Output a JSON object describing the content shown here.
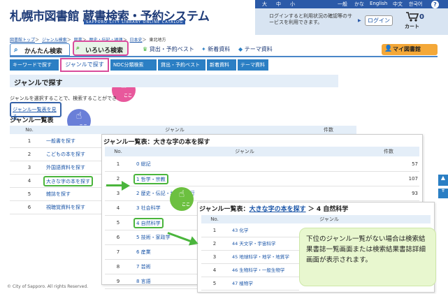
{
  "header": {
    "logo": "札幌市図書館 蔵書検索・予約システム",
    "logo_sub": "SAPPORO CITY LIBRARY ONLINE CATALOG",
    "font_size_controls": [
      "大",
      "中",
      "小"
    ],
    "lang_links": [
      "一般",
      "かな",
      "English",
      "中文",
      "한국어"
    ],
    "help_label": "?",
    "login_message": "ログインすると利用状況の確認等のサービスを利用できます。",
    "login_button": "ログイン",
    "cart_count": "0",
    "cart_label": "カート"
  },
  "breadcrumb": [
    "図書館トップ",
    "ジャンル検索",
    "図書",
    "歴史・伝記・地理",
    "日本史",
    "東北地方"
  ],
  "tabs": {
    "simple": "かんたん検索",
    "various": "いろいろ検索",
    "links": [
      "貸出・予約ベスト",
      "新着資料",
      "テーマ資料"
    ],
    "mylibrary": "マイ図書館"
  },
  "subtabs": [
    "キーワードで探す",
    "ジャンルで探す",
    "NDC分類検索",
    "貸出・予約ベスト",
    "新着資料",
    "テーマ資料"
  ],
  "section_title": "ジャンルで探す",
  "description": "ジャンルを選択することで、検索することができ",
  "genre_list_link": "ジャンル一覧表を見る",
  "hand_label": "ここ",
  "table1": {
    "title": "ジャンル一覧表",
    "headers": [
      "No.",
      "ジャンル",
      "件数"
    ],
    "rows": [
      {
        "no": "1",
        "label": "一般書を探す"
      },
      {
        "no": "2",
        "label": "こどもの本を探す"
      },
      {
        "no": "3",
        "label": "外国語資料を探す"
      },
      {
        "no": "4",
        "label": "大きな字の本を探す"
      },
      {
        "no": "5",
        "label": "雑誌を探す"
      },
      {
        "no": "6",
        "label": "視聴覚資料を探す"
      }
    ]
  },
  "table2": {
    "title": "ジャンル一覧表：大きな字の本を探す",
    "headers": [
      "No.",
      "ジャンル",
      "件数"
    ],
    "rows": [
      {
        "no": "1",
        "label": "0 総記",
        "count": "57"
      },
      {
        "no": "2",
        "label": "1 哲学・宗教",
        "count": "107"
      },
      {
        "no": "3",
        "label": "2 歴史・伝記・地理・紀行",
        "count": "93"
      },
      {
        "no": "4",
        "label": "3 社会科学",
        "count": ""
      },
      {
        "no": "5",
        "label": "4 自然科学",
        "count": ""
      },
      {
        "no": "6",
        "label": "5 技術・家政学",
        "count": ""
      },
      {
        "no": "7",
        "label": "6 産業",
        "count": ""
      },
      {
        "no": "8",
        "label": "7 芸術",
        "count": ""
      },
      {
        "no": "9",
        "label": "8 言語",
        "count": ""
      }
    ]
  },
  "table3": {
    "title_prefix": "ジャンル一覧表：",
    "title_link": "大きな字の本を探す",
    "title_suffix": "＞ 4 自然科学",
    "headers": [
      "No.",
      "ジャンル"
    ],
    "rows": [
      {
        "no": "1",
        "label": "43 化学"
      },
      {
        "no": "2",
        "label": "44 天文学・宇宙科学"
      },
      {
        "no": "3",
        "label": "45 地球科学・地学・地質学"
      },
      {
        "no": "4",
        "label": "46 生物科学・一般生物学"
      },
      {
        "no": "5",
        "label": "47 植物学"
      }
    ]
  },
  "callout": "下位のジャンル一覧がない場合は検索結果書誌一覧画面または検索結果書誌詳細画面が表示されます。",
  "footer": "© City of Sapporo. All rights Reserved.",
  "colors": {
    "accent": "#2b7fc4",
    "highlight_pink": "#d94c9c",
    "highlight_green": "#4ab53c",
    "hand_blue": "#6a7fd8",
    "hand_pink": "#e8589c",
    "hand_green": "#6cc040"
  }
}
